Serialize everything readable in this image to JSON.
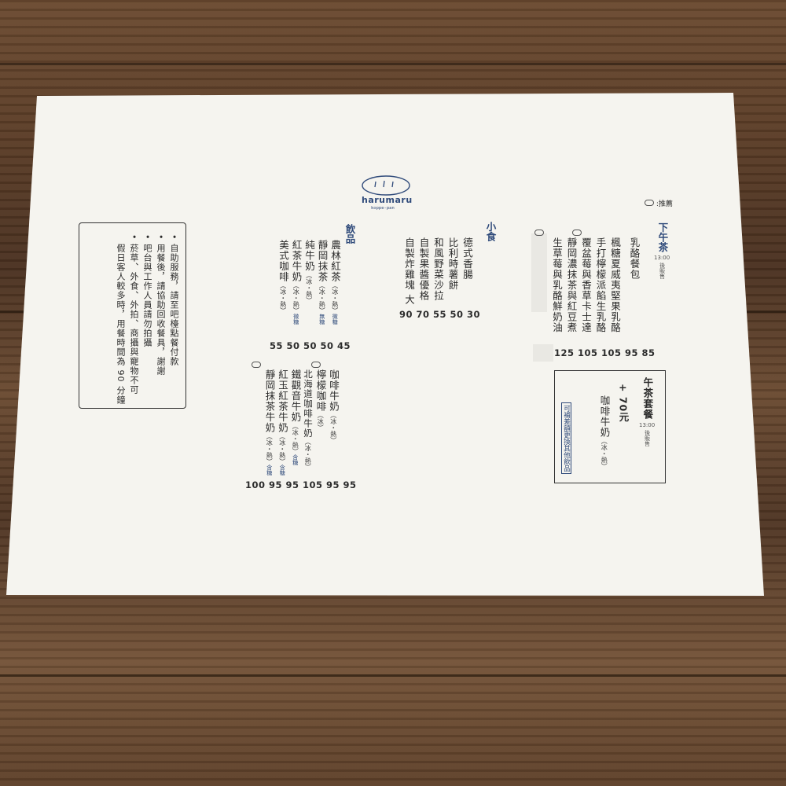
{
  "logo": {
    "name": "harumaru",
    "sub": "koppe-pan"
  },
  "legend": {
    "label": ":推薦"
  },
  "rules": [
    "• 自助服務，請至吧檯點餐付款",
    "• 用餐後，請協助回收餐具，謝謝",
    "• 吧台與工作人員請勿拍攝",
    "• 菸草、外食、外拍、商攝與寵物不可",
    "　假日客人較多時，用餐時間為 90 分鐘"
  ],
  "drinks": {
    "heading": "飲品",
    "group1": {
      "items": [
        {
          "name": "農林紅茶",
          "note": "（冰・熱）",
          "tag": "微糖"
        },
        {
          "name": "靜岡抹茶",
          "note": "（冰・熱）",
          "tag": "無糖"
        },
        {
          "name": "純牛奶",
          "note": "（冰・熱）",
          "tag": ""
        },
        {
          "name": "紅茶牛奶",
          "note": "（冰・熱）",
          "tag": "微糖"
        },
        {
          "name": "美式咖啡",
          "note": "（冰・熱）",
          "tag": ""
        }
      ],
      "prices": "55 50 50 50 45"
    },
    "group2": {
      "items": [
        {
          "name": "咖啡牛奶",
          "note": "（冰・熱）",
          "tag": ""
        },
        {
          "name": "檸檬咖啡",
          "note": "（冰）",
          "tag": ""
        },
        {
          "name": "北海道咖啡牛奶",
          "note": "（冰・熱）",
          "tag": ""
        },
        {
          "name": "鐵觀音牛奶",
          "note": "（冰・熱）",
          "tag": "含糖"
        },
        {
          "name": "紅玉紅茶牛奶",
          "note": "（冰・熱）",
          "tag": "含糖"
        },
        {
          "name": "靜岡抹茶牛奶",
          "note": "（冰・熱）",
          "tag": "含糖"
        }
      ],
      "prices": "100 95 95 105 95 95"
    }
  },
  "snacks": {
    "heading": "小食",
    "items": [
      "德式香腸",
      "比利時薯餅",
      "和風野菜沙拉",
      "自製果醬優格",
      "自製炸雞塊 大"
    ],
    "prices": "90 70 55 50 30"
  },
  "bread": {
    "heading": "乳酪餐包",
    "items": [
      "楓糖夏威夷堅果乳酪",
      "手打檸檬派餡生乳酪",
      "覆盆莓與香草卡士達",
      "靜岡濃抹茶與紅豆煮",
      "生草莓與乳酪鮮奶油"
    ],
    "prices": "125 105 105 95 85"
  },
  "teatime": {
    "heading": "下午茶",
    "time": "13:00",
    "sub": "後販售"
  },
  "set": {
    "heading": "午茶套餐",
    "time": "13:00",
    "sub": "後販售",
    "plus": "+ 70元",
    "drink": "咖啡牛奶",
    "drink_note": "（冰・熱）",
    "change": "可補差額更換其他飲品"
  },
  "colors": {
    "accent": "#2f4a7a",
    "paper": "#f5f4ef",
    "wood": "#5a3c26"
  }
}
